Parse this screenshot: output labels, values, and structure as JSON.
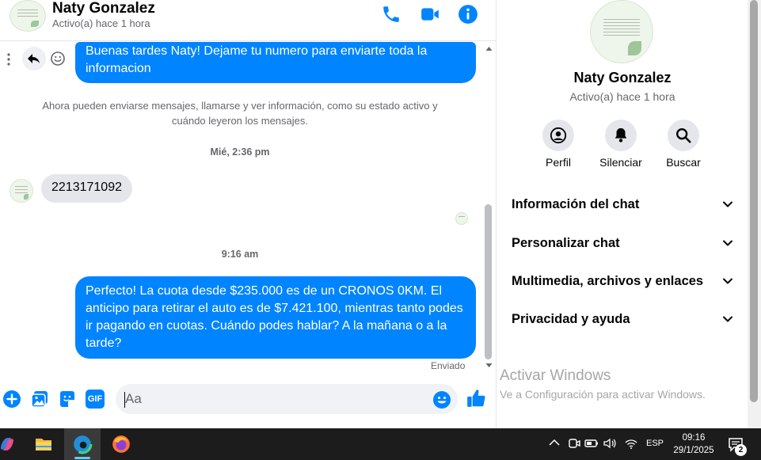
{
  "header": {
    "contact_name": "Naty Gonzalez",
    "contact_status": "Activo(a) hace 1 hora",
    "icons": [
      "phone-icon",
      "video-camera-icon",
      "info-icon"
    ]
  },
  "messages": {
    "msg_1": "Buenas tardes Naty! Dejame tu numero para enviarte toda la informacion",
    "system_info": "Ahora pueden enviarse mensajes, llamarse y ver información, como su estado activo y cuándo leyeron los mensajes.",
    "time_1": "Mié, 2:36 pm",
    "msg_2": "2213171092",
    "time_2": "9:16 am",
    "msg_3": "Perfecto! La cuota desde $235.000 es de un CRONOS 0KM. El anticipo para retirar el auto es de $7.421.100, mientras tanto podes ir pagando en cuotas. Cuándo podes hablar? A la mañana o a la tarde?",
    "sent_status": "Enviado"
  },
  "composer": {
    "placeholder": "Aa",
    "gif_label": "GIF"
  },
  "right_panel": {
    "name": "Naty Gonzalez",
    "status": "Activo(a) hace 1 hora",
    "actions": {
      "profile": "Perfil",
      "mute": "Silenciar",
      "search": "Buscar"
    },
    "sections": {
      "info": "Información del chat",
      "custom": "Personalizar chat",
      "media": "Multimedia, archivos y enlaces",
      "privacy": "Privacidad y ayuda"
    }
  },
  "watermark": {
    "title": "Activar Windows",
    "subtitle": "Ve a Configuración para activar Windows."
  },
  "taskbar": {
    "language": "ESP",
    "time": "09:16",
    "date": "29/1/2025",
    "notification_count": "2"
  },
  "colors": {
    "accent": "#0084ff",
    "incoming_bubble": "#e4e6eb",
    "taskbar": "#1c1c1c"
  }
}
